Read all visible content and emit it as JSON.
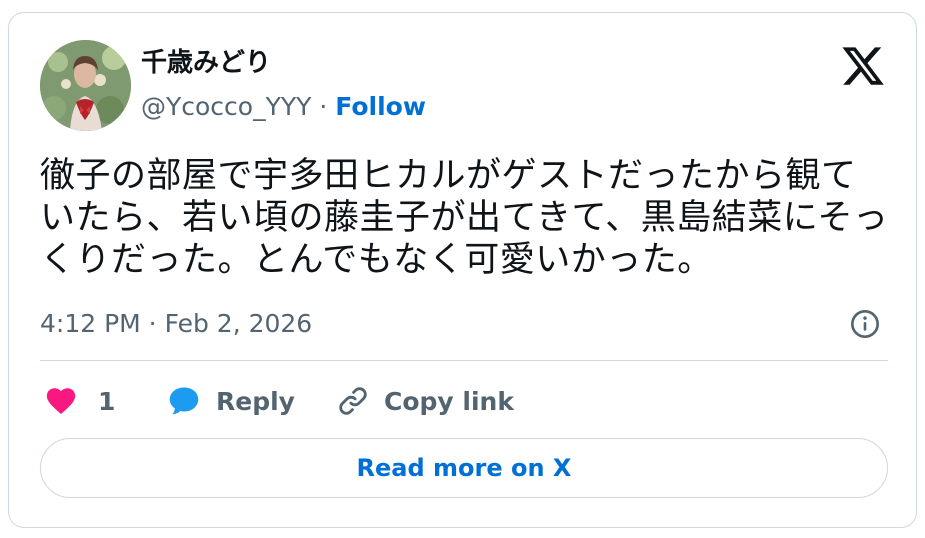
{
  "author": {
    "display_name": "千歳みどり",
    "handle": "@Ycocco_YYY",
    "separator": " · ",
    "follow_label": "Follow"
  },
  "tweet": {
    "text": "徹子の部屋で宇多田ヒカルがゲストだったから観ていたら、若い頃の藤圭子が出てきて、黒島結菜にそっくりだった。とんでもなく可愛いかった。",
    "timestamp": "4:12 PM · Feb 2, 2026"
  },
  "actions": {
    "like_count": "1",
    "reply_label": "Reply",
    "copy_label": "Copy link"
  },
  "read_more_label": "Read more on X",
  "colors": {
    "like": "#f91880",
    "reply": "#1d9bf0",
    "link": "#006fd6",
    "muted": "#536471",
    "border": "#cfd9de"
  },
  "icons": {
    "brand": "x-logo-icon",
    "info": "info-icon",
    "like": "heart-icon",
    "reply": "speech-bubble-icon",
    "copy": "link-icon"
  }
}
